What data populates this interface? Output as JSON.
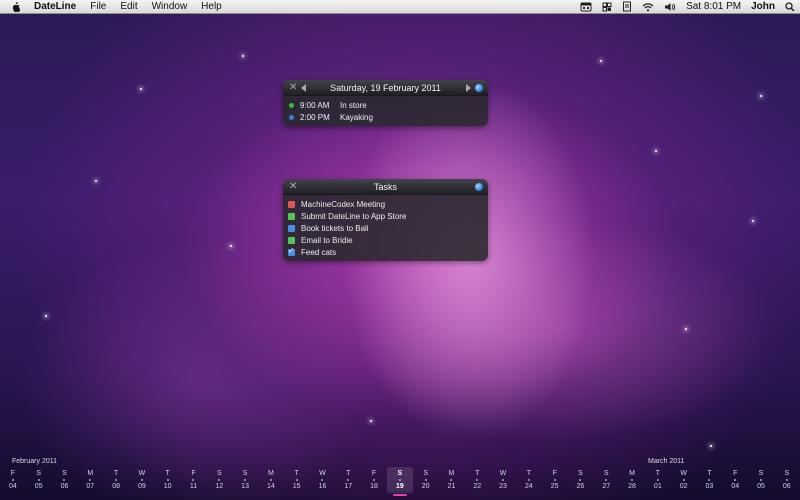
{
  "menubar": {
    "app_name": "DateLine",
    "menus": [
      "File",
      "Edit",
      "Window",
      "Help"
    ],
    "clock": "Sat 8:01 PM",
    "user": "John"
  },
  "calendar_widget": {
    "title": "Saturday, 19 February 2011",
    "events": [
      {
        "time": "9:00 AM",
        "name": "In store",
        "color": "#34c23a"
      },
      {
        "time": "2:00 PM",
        "name": "Kayaking",
        "color": "#3a7be0"
      }
    ]
  },
  "tasks_widget": {
    "title": "Tasks",
    "tasks": [
      {
        "label": "MachineCodex Meeting",
        "color": "#e0575a",
        "checked": false
      },
      {
        "label": "Submit DateLine to App Store",
        "color": "#54c45a",
        "checked": false
      },
      {
        "label": "Book tickets to Bali",
        "color": "#4b8fe0",
        "checked": false
      },
      {
        "label": "Email to Bridie",
        "color": "#54c45a",
        "checked": false
      },
      {
        "label": "Feed cats",
        "color": "#4b8fe0",
        "checked": true
      }
    ]
  },
  "dateline": {
    "month_labels": [
      "February 2011",
      "March 2011"
    ],
    "days": [
      {
        "dow": "F",
        "num": "04"
      },
      {
        "dow": "S",
        "num": "05"
      },
      {
        "dow": "S",
        "num": "06"
      },
      {
        "dow": "M",
        "num": "07"
      },
      {
        "dow": "T",
        "num": "08"
      },
      {
        "dow": "W",
        "num": "09"
      },
      {
        "dow": "T",
        "num": "10"
      },
      {
        "dow": "F",
        "num": "11"
      },
      {
        "dow": "S",
        "num": "12"
      },
      {
        "dow": "S",
        "num": "13"
      },
      {
        "dow": "M",
        "num": "14"
      },
      {
        "dow": "T",
        "num": "15"
      },
      {
        "dow": "W",
        "num": "16"
      },
      {
        "dow": "T",
        "num": "17"
      },
      {
        "dow": "F",
        "num": "18"
      },
      {
        "dow": "S",
        "num": "19",
        "today": true
      },
      {
        "dow": "S",
        "num": "20"
      },
      {
        "dow": "M",
        "num": "21"
      },
      {
        "dow": "T",
        "num": "22"
      },
      {
        "dow": "W",
        "num": "23"
      },
      {
        "dow": "T",
        "num": "24"
      },
      {
        "dow": "F",
        "num": "25"
      },
      {
        "dow": "S",
        "num": "26"
      },
      {
        "dow": "S",
        "num": "27"
      },
      {
        "dow": "M",
        "num": "28"
      },
      {
        "dow": "T",
        "num": "01"
      },
      {
        "dow": "W",
        "num": "02"
      },
      {
        "dow": "T",
        "num": "03"
      },
      {
        "dow": "F",
        "num": "04"
      },
      {
        "dow": "S",
        "num": "05"
      },
      {
        "dow": "S",
        "num": "06"
      }
    ]
  }
}
